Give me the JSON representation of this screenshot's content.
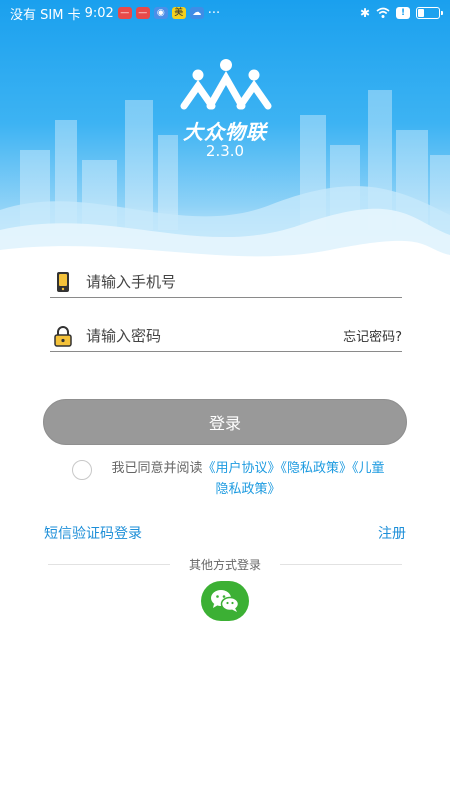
{
  "status_bar": {
    "carrier": "没有 SIM 卡",
    "time": "9:02",
    "overflow": "···",
    "battery_level": 0.3
  },
  "brand": {
    "name": "大众物联",
    "version": "2.3.0"
  },
  "form": {
    "phone_placeholder": "请输入手机号",
    "password_placeholder": "请输入密码",
    "forgot_password": "忘记密码?",
    "login_button": "登录"
  },
  "agreement": {
    "prefix": "我已同意并阅读",
    "user_agreement": "《用户协议》",
    "privacy_policy": "《隐私政策》",
    "children_privacy": "《儿童隐私政策》",
    "checked": false
  },
  "links": {
    "sms_login": "短信验证码登录",
    "register": "注册"
  },
  "other_login": {
    "label": "其他方式登录",
    "wechat_icon": "wechat-icon"
  },
  "colors": {
    "primary_blue": "#1aa0ee",
    "link_blue": "#1e8fd8",
    "button_gray": "#999999",
    "wechat_green": "#3cb034"
  }
}
